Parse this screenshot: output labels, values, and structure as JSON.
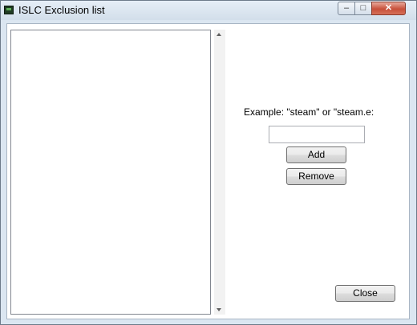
{
  "window": {
    "title": "ISLC Exclusion list",
    "controls": {
      "minimize": "–",
      "maximize": "□",
      "close": "✕"
    }
  },
  "exclusion_list": {
    "items": []
  },
  "form": {
    "example_label": "Example: \"steam\" or \"steam.e:",
    "entry_value": ""
  },
  "buttons": {
    "add": "Add",
    "remove": "Remove",
    "close": "Close"
  },
  "icons": {
    "app": "app-icon",
    "scroll_up": "scroll-up-icon",
    "scroll_down": "scroll-down-icon"
  }
}
